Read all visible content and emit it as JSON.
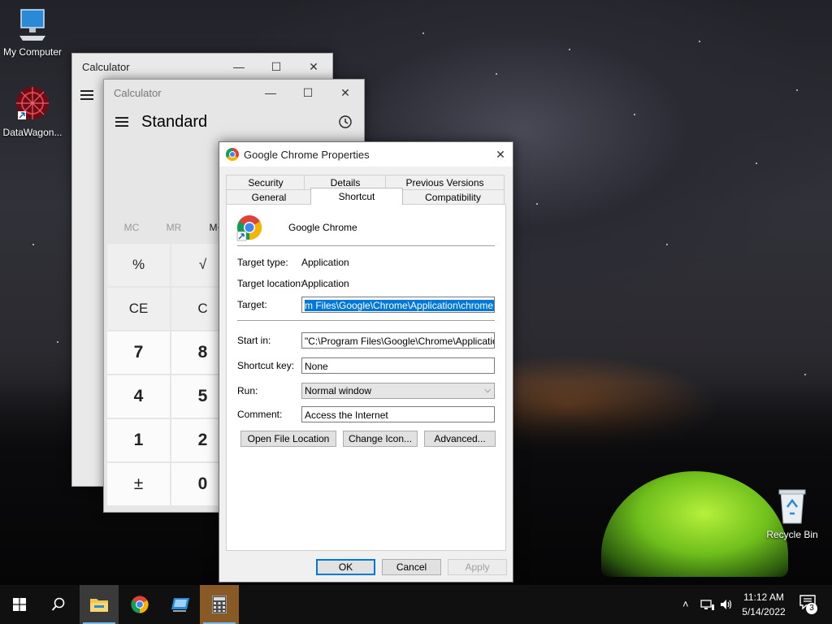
{
  "desktop": {
    "icons": [
      {
        "label": "My Computer"
      },
      {
        "label": "DataWagon..."
      },
      {
        "label": "Recycle Bin"
      }
    ]
  },
  "calc_back": {
    "title": "Calculator",
    "buttons": {
      "minimize": "—",
      "maximize": "☐",
      "close": "✕"
    }
  },
  "calc_front": {
    "title": "Calculator",
    "mode": "Standard",
    "memory": [
      "MC",
      "MR",
      "M+"
    ],
    "keys": [
      [
        "%",
        "√"
      ],
      [
        "CE",
        "C"
      ],
      [
        "7",
        "8"
      ],
      [
        "4",
        "5"
      ],
      [
        "1",
        "2"
      ],
      [
        "±",
        "0"
      ]
    ],
    "buttons": {
      "minimize": "—",
      "maximize": "☐",
      "close": "✕"
    }
  },
  "dialog": {
    "title": "Google Chrome Properties",
    "close": "✕",
    "tabs_back": [
      "Security",
      "Details",
      "Previous Versions"
    ],
    "tabs_front": [
      "General",
      "Shortcut",
      "Compatibility"
    ],
    "selected_tab": "Shortcut",
    "app_name": "Google Chrome",
    "target_type_label": "Target type:",
    "target_type_value": "Application",
    "target_location_label": "Target location:",
    "target_location_value": "Application",
    "target_label": "Target:",
    "target_value": "m Files\\Google\\Chrome\\Application\\chrome.exe\"",
    "start_in_label": "Start in:",
    "start_in_value": "\"C:\\Program Files\\Google\\Chrome\\Application\"",
    "shortcut_key_label": "Shortcut key:",
    "shortcut_key_value": "None",
    "run_label": "Run:",
    "run_value": "Normal window",
    "comment_label": "Comment:",
    "comment_value": "Access the Internet",
    "btn_open_location": "Open File Location",
    "btn_change_icon": "Change Icon...",
    "btn_advanced": "Advanced...",
    "btn_ok": "OK",
    "btn_cancel": "Cancel",
    "btn_apply": "Apply"
  },
  "taskbar": {
    "time": "11:12 AM",
    "date": "5/14/2022",
    "notifications": "3",
    "apps": [
      "file-explorer-icon",
      "chrome-icon",
      "remote-app-icon",
      "calculator-icon"
    ]
  }
}
